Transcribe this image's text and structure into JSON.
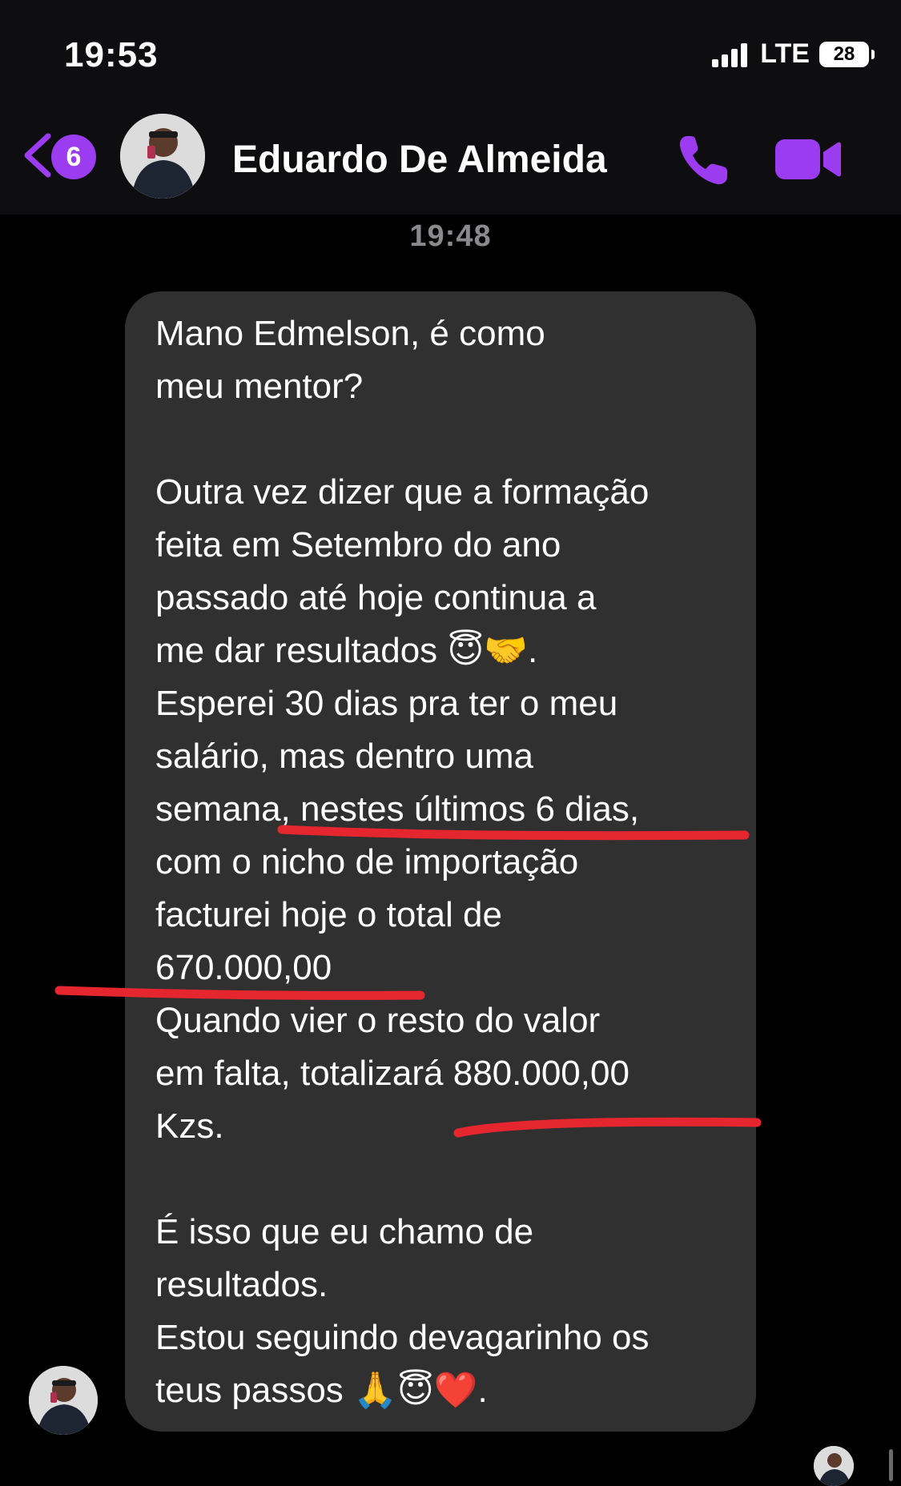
{
  "status_bar": {
    "time": "19:53",
    "network": "LTE",
    "battery": "28"
  },
  "header": {
    "unread_count": "6",
    "contact_name": "Eduardo De Almeida"
  },
  "conversation": {
    "timestamp": "19:48",
    "message": {
      "text": "Mano Edmelson, é como\nmeu mentor?\n\nOutra vez dizer que a formação\nfeita em Setembro do ano\npassado até hoje continua a\nme dar resultados 😇🤝.\nEsperei 30 dias pra ter o meu\nsalário, mas dentro uma\nsemana, nestes últimos 6 dias,\ncom o nicho de importação\nfacturei hoje o total de\n670.000,00\nQuando vier o resto do valor\nem falta, totalizará 880.000,00\nKzs.\n\nÉ isso que eu chamo de\nresultados.\nEstou seguindo devagarinho os\nteus passos 🙏😇❤️."
    }
  },
  "colors": {
    "accent": "#9c3cf0",
    "bubble": "#303030",
    "annotation": "#e6262f",
    "timestamp": "#8a8a8e"
  },
  "icons": {
    "back": "chevron-left-icon",
    "call": "phone-icon",
    "video": "video-camera-icon"
  }
}
